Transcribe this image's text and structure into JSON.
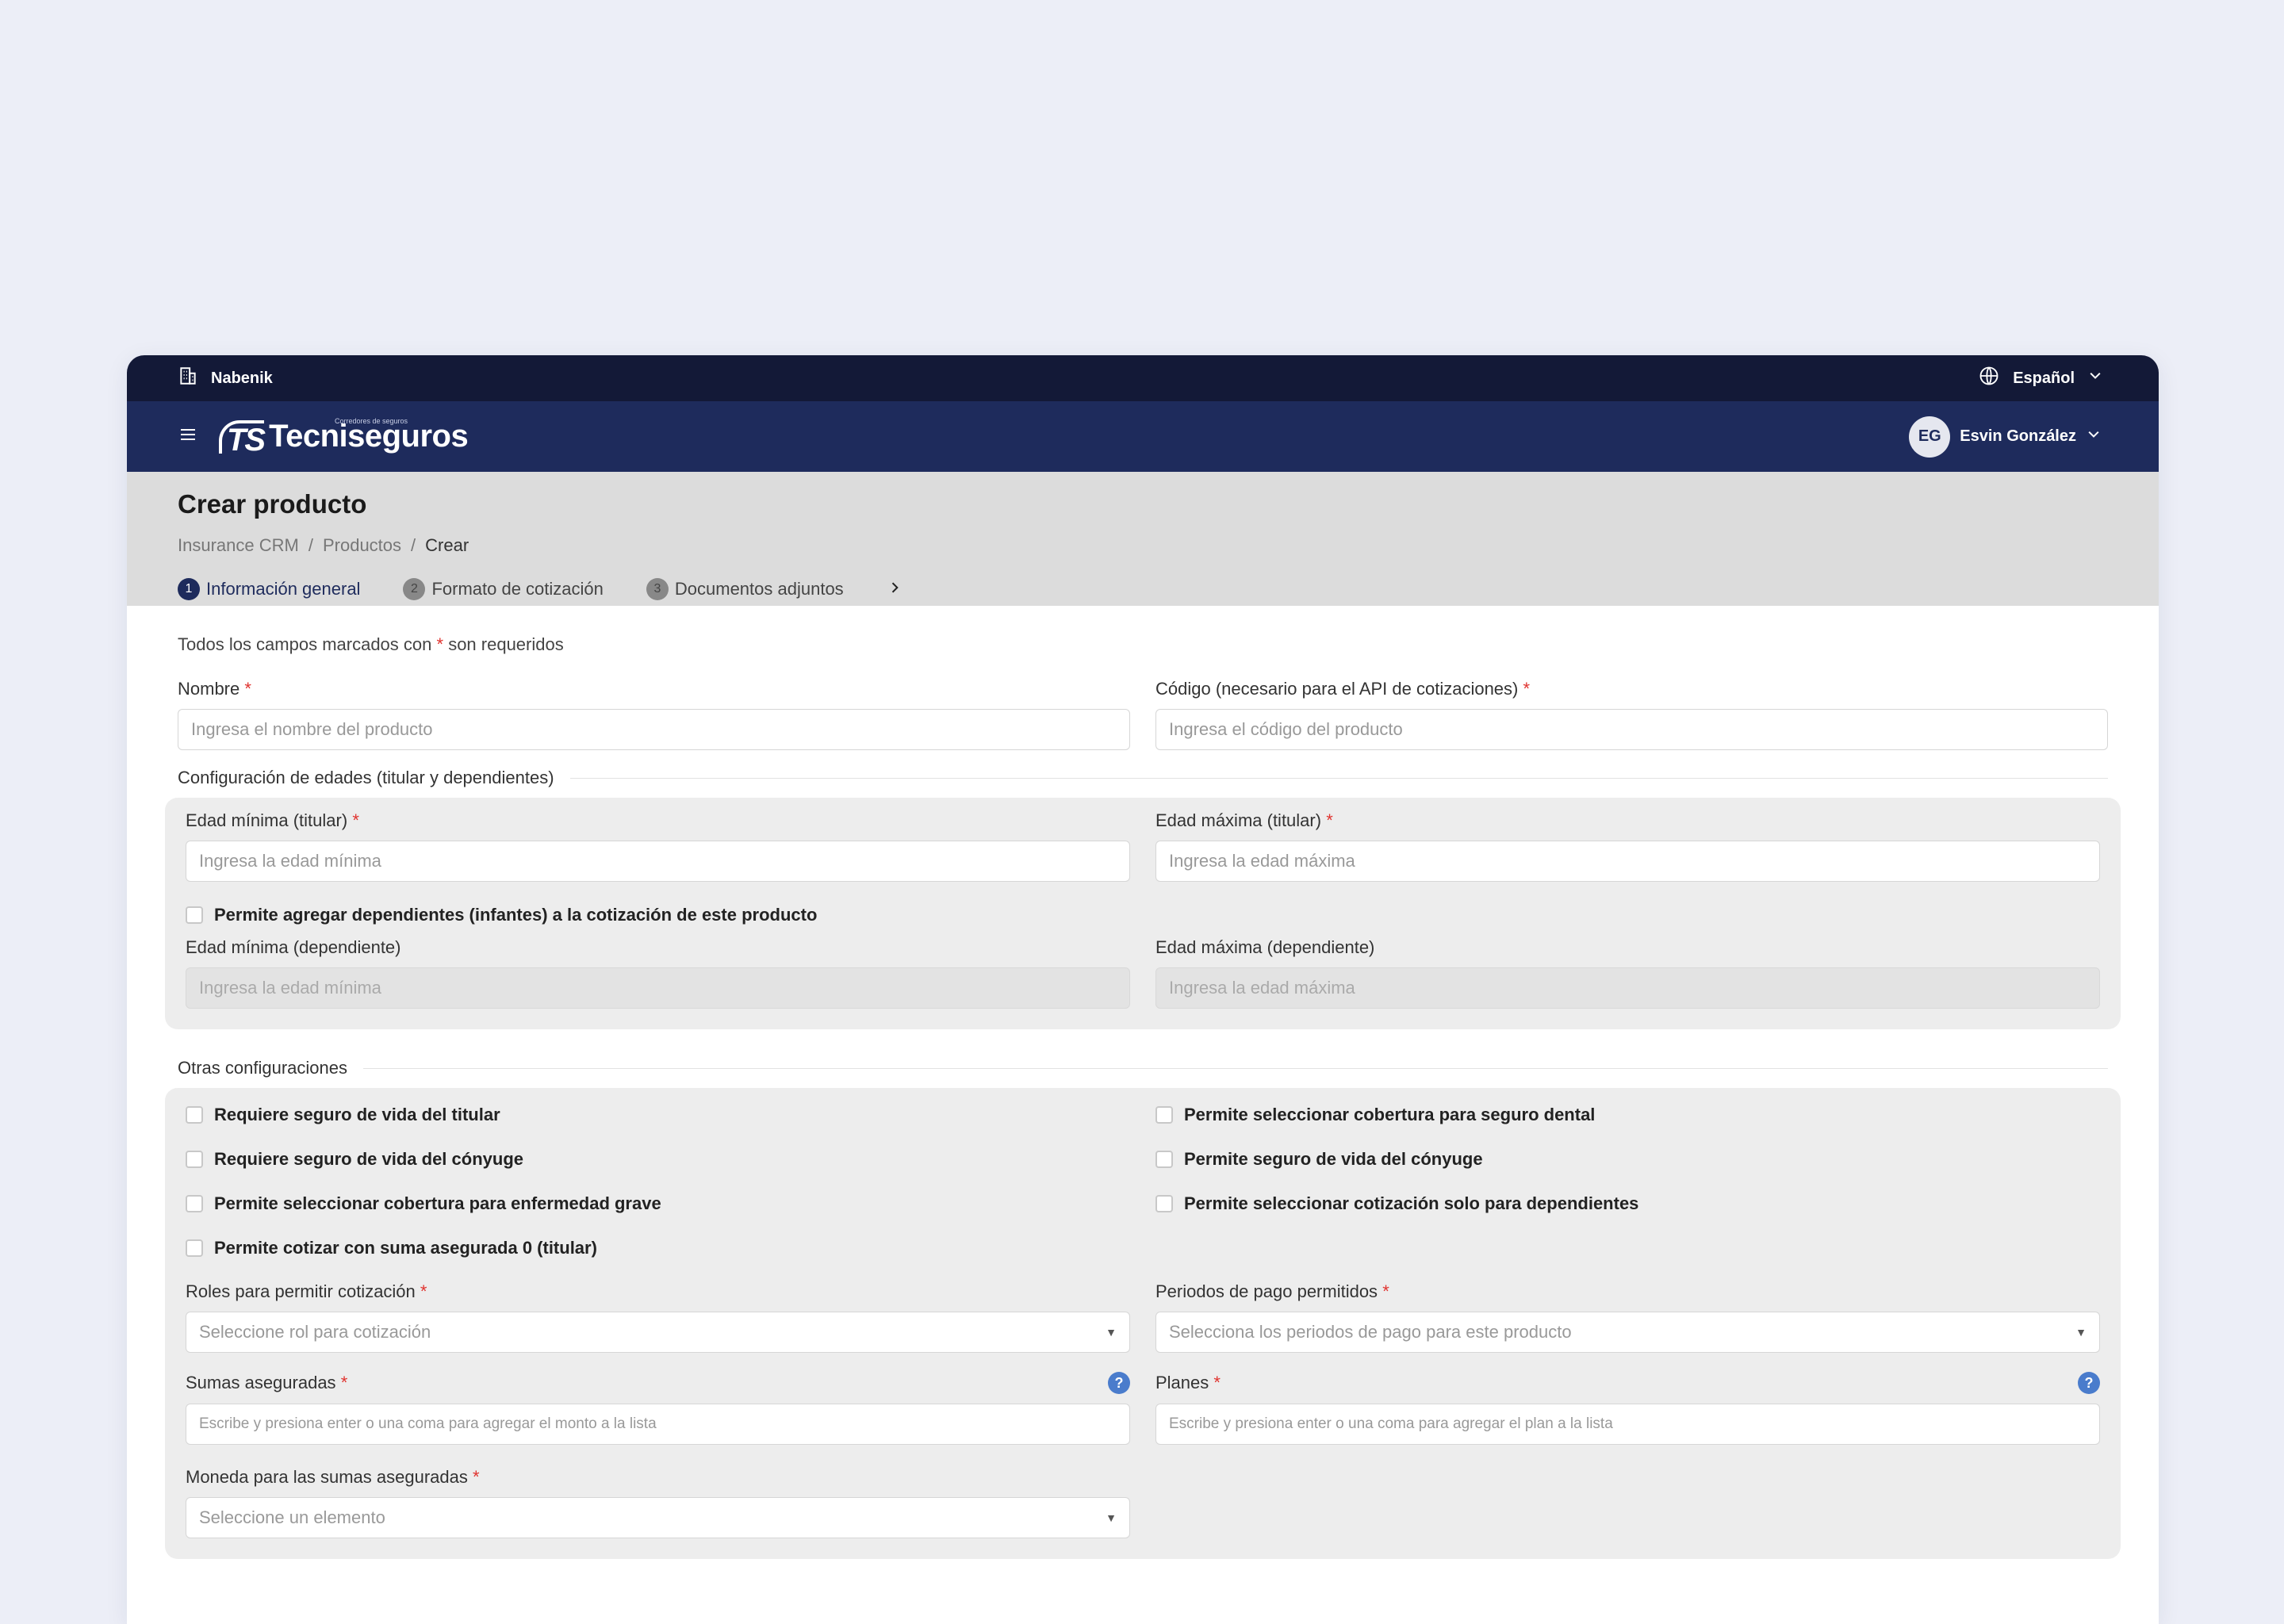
{
  "topbar": {
    "org": "Nabenik",
    "language": "Español"
  },
  "navbar": {
    "brand": "Tecniseguros",
    "brand_mark": "TS",
    "brand_tagline": "Corredores de seguros",
    "user_initials": "EG",
    "user_name": "Esvin González"
  },
  "header": {
    "title": "Crear producto",
    "breadcrumb": [
      "Insurance CRM",
      "Productos",
      "Crear"
    ],
    "breadcrumb_sep": "/",
    "steps": [
      {
        "num": "1",
        "label": "Información general"
      },
      {
        "num": "2",
        "label": "Formato de cotización"
      },
      {
        "num": "3",
        "label": "Documentos adjuntos"
      }
    ]
  },
  "form": {
    "req_note_pre": "Todos los campos marcados con",
    "req_note_post": "son requeridos",
    "required_mark": "*",
    "name_label": "Nombre",
    "name_placeholder": "Ingresa el nombre del producto",
    "code_label": "Código (necesario para el API de cotizaciones)",
    "code_placeholder": "Ingresa el código del producto",
    "ages_section": "Configuración de edades (titular y dependientes)",
    "min_age_label": "Edad mínima (titular)",
    "min_age_placeholder": "Ingresa la edad mínima",
    "max_age_label": "Edad máxima (titular)",
    "max_age_placeholder": "Ingresa la edad máxima",
    "allow_dependents": "Permite agregar dependientes (infantes) a la cotización de este producto",
    "dep_min_label": "Edad mínima (dependiente)",
    "dep_min_placeholder": "Ingresa la edad mínima",
    "dep_max_label": "Edad máxima (dependiente)",
    "dep_max_placeholder": "Ingresa la edad máxima",
    "other_section": "Otras configuraciones",
    "checks_left": [
      "Requiere seguro de vida del titular",
      "Requiere seguro de vida del cónyuge",
      "Permite seleccionar cobertura para enfermedad grave",
      "Permite cotizar con suma asegurada 0 (titular)"
    ],
    "checks_right": [
      "Permite seleccionar cobertura para seguro dental",
      "Permite seguro de vida del cónyuge",
      "Permite seleccionar cotización solo para dependientes"
    ],
    "roles_label": "Roles para permitir cotización",
    "roles_placeholder": "Seleccione rol para cotización",
    "periods_label": "Periodos de pago permitidos",
    "periods_placeholder": "Selecciona los periodos de pago para este producto",
    "sums_label": "Sumas aseguradas",
    "sums_placeholder": "Escribe y presiona enter o una coma para agregar el monto a la lista",
    "plans_label": "Planes",
    "plans_placeholder": "Escribe y presiona enter o una coma para agregar el plan a la lista",
    "currency_label": "Moneda para las sumas aseguradas",
    "currency_placeholder": "Seleccione un elemento",
    "help_glyph": "?"
  }
}
